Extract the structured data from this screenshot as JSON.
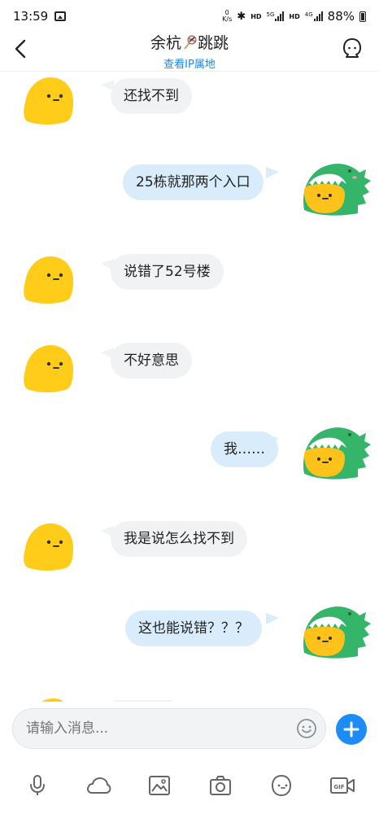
{
  "status_bar": {
    "time": "13:59",
    "net_speed_top": "0",
    "net_speed_unit": "K/s",
    "hd1": "HD",
    "sig1_tag": "5G",
    "hd2": "HD",
    "sig2_tag": "4G",
    "battery_text": "88%"
  },
  "header": {
    "title_part1": "余杭",
    "title_part2": "跳跳",
    "subtitle": "查看IP属地"
  },
  "messages": [
    {
      "side": "in",
      "text": "还找不到"
    },
    {
      "side": "out",
      "text": "25栋就那两个入口"
    },
    {
      "side": "in",
      "text": "说错了52号楼"
    },
    {
      "side": "in",
      "text": "不好意思"
    },
    {
      "side": "out",
      "text": "我……"
    },
    {
      "side": "in",
      "text": "我是说怎么找不到"
    },
    {
      "side": "out",
      "text": "这也能说错？？？"
    }
  ],
  "composer": {
    "placeholder": "请输入消息..."
  },
  "toolbar": {
    "icons": [
      "microphone-icon",
      "cloud-icon",
      "image-icon",
      "camera-icon",
      "emoji-icon",
      "gif-icon"
    ],
    "gif_label": "GIF"
  },
  "colors": {
    "accent": "#1d8cf8",
    "out_bubble": "#d9ecfb",
    "in_bubble": "#f1f2f4",
    "blob_yellow": "#ffcc1a",
    "dino_green": "#35b56a"
  }
}
